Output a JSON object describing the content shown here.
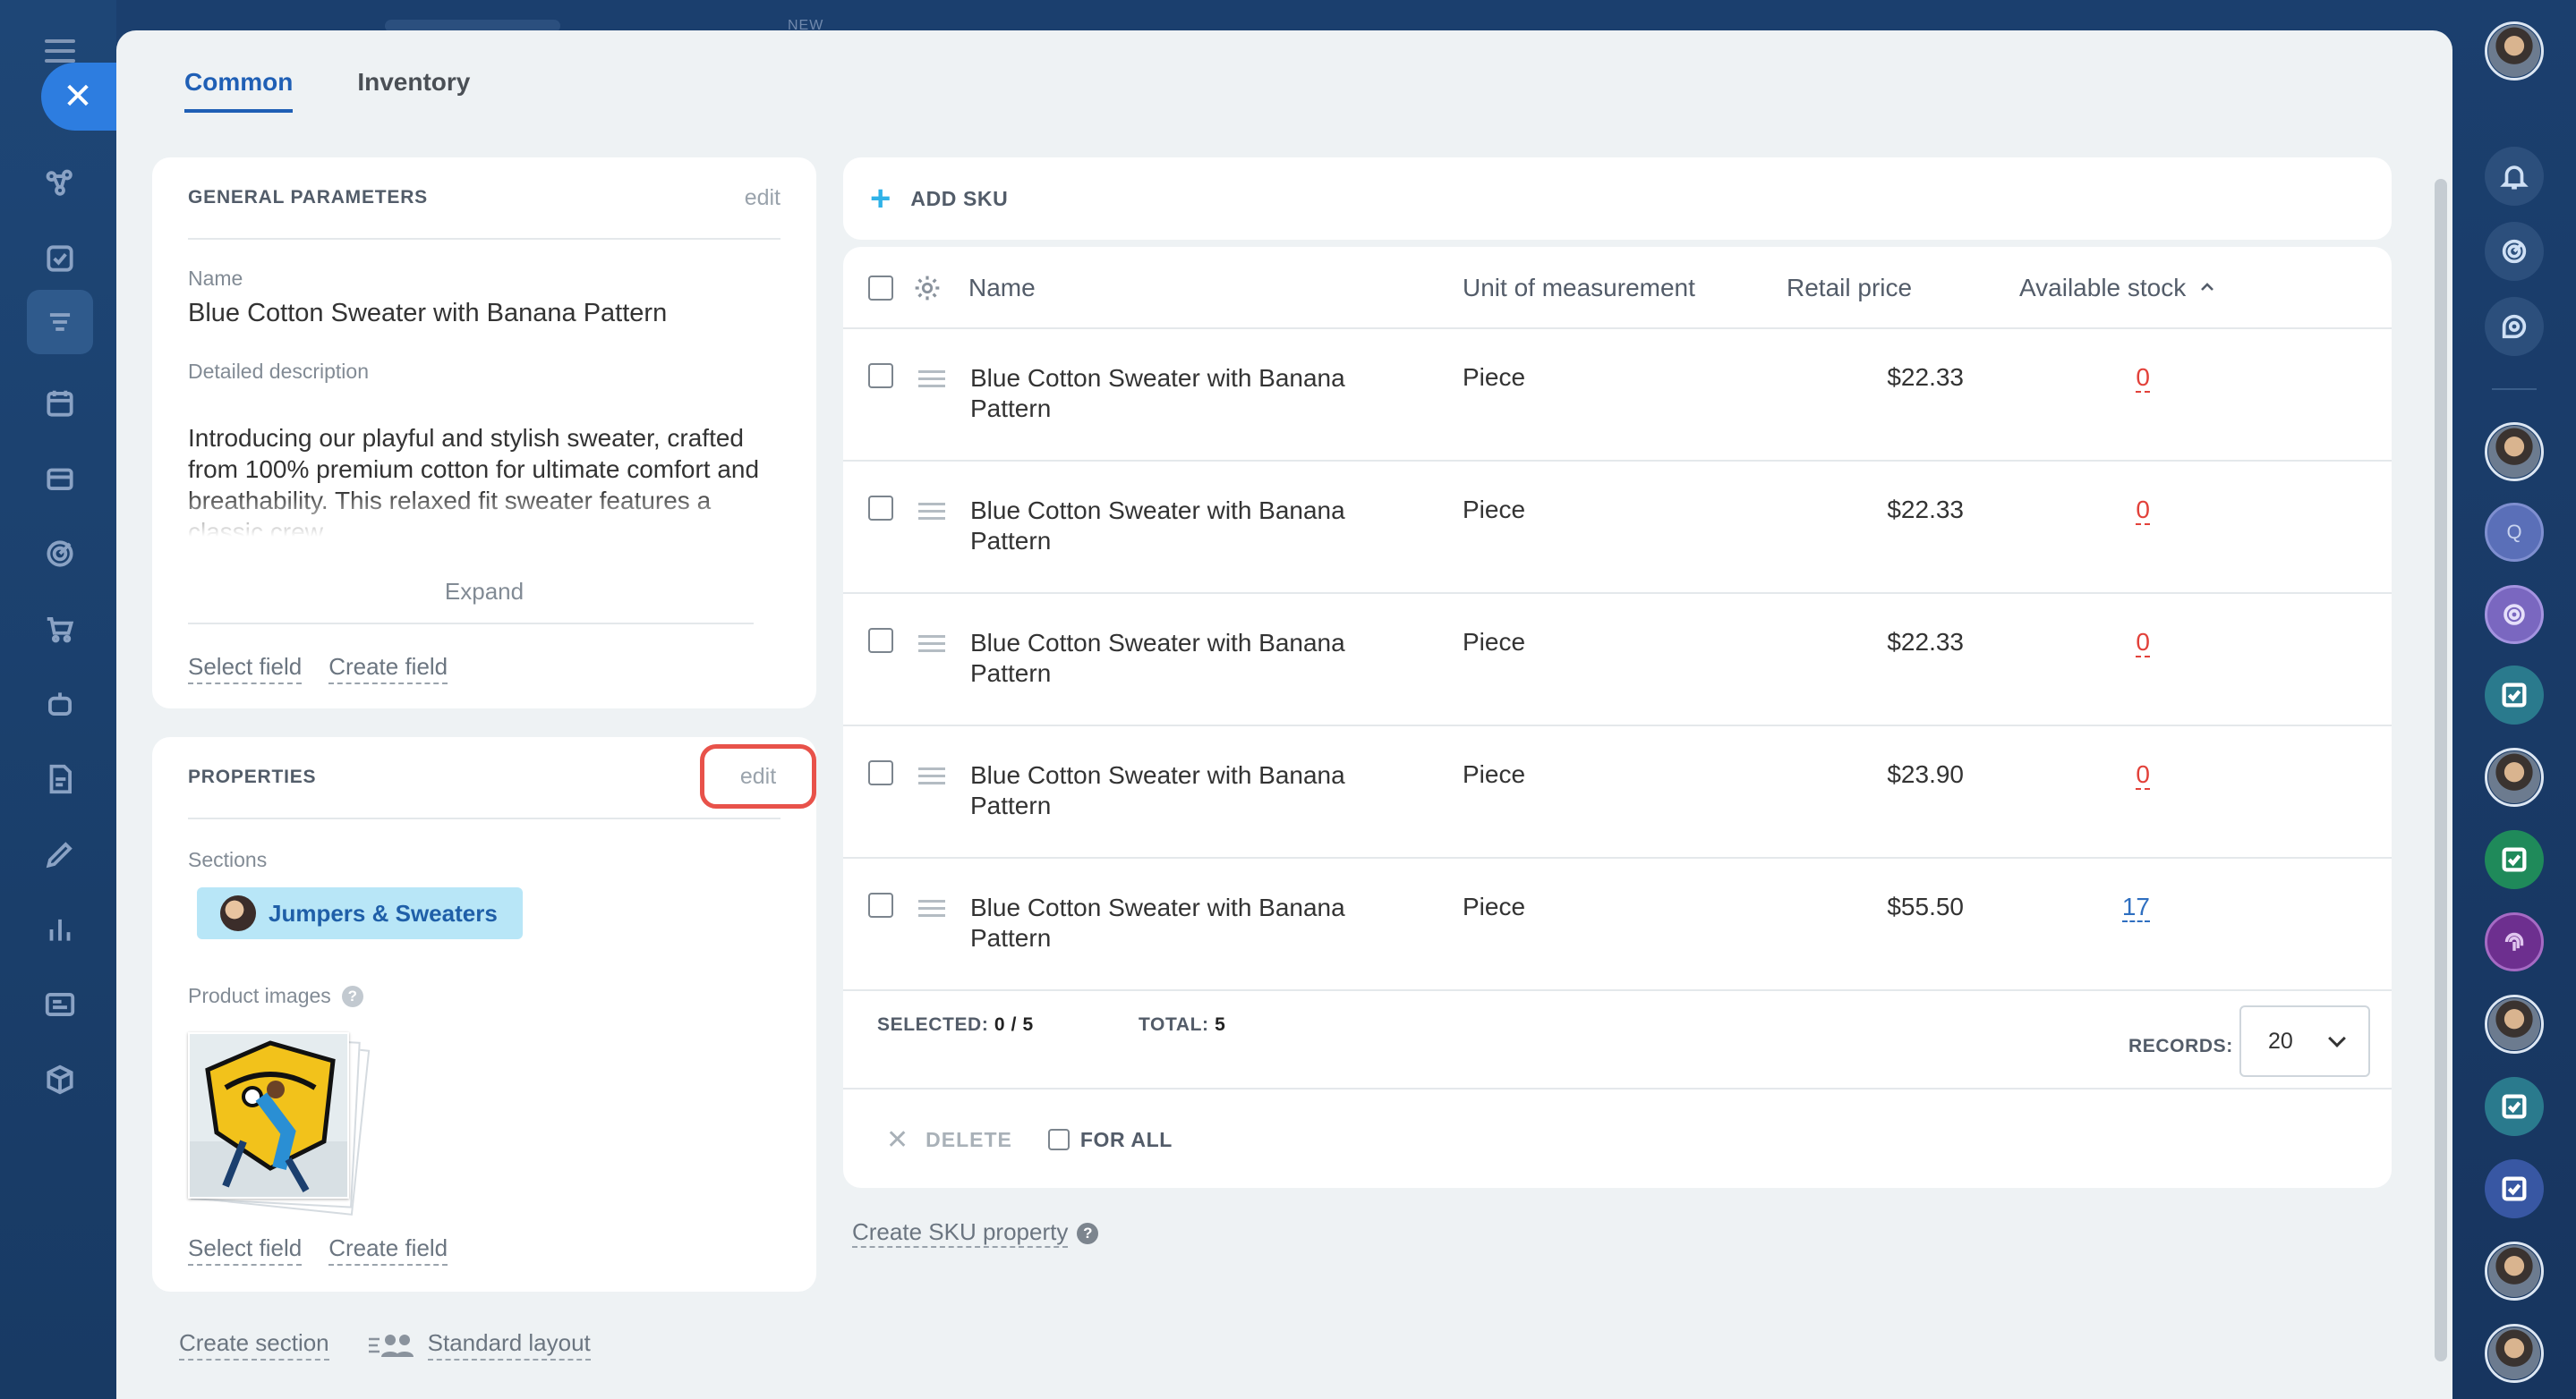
{
  "top": {
    "new_badge": "NEW"
  },
  "tabs": [
    {
      "label": "Common",
      "active": true
    },
    {
      "label": "Inventory",
      "active": false
    }
  ],
  "general": {
    "title": "GENERAL PARAMETERS",
    "edit": "edit",
    "name_label": "Name",
    "name_value": "Blue Cotton Sweater with Banana Pattern",
    "desc_label": "Detailed description",
    "desc_text": "Introducing our playful and stylish sweater, crafted from 100% premium cotton for ultimate comfort and breathability. This relaxed fit sweater features a classic crew",
    "expand": "Expand",
    "select_field": "Select field",
    "create_field": "Create field"
  },
  "properties": {
    "title": "PROPERTIES",
    "edit": "edit",
    "sections_label": "Sections",
    "section_chip": "Jumpers & Sweaters",
    "images_label": "Product images",
    "help": "?",
    "select_field": "Select field",
    "create_field": "Create field"
  },
  "bottom": {
    "create_section": "Create section",
    "standard_layout": "Standard layout"
  },
  "sku": {
    "add_label": "ADD SKU",
    "columns": {
      "name": "Name",
      "unit": "Unit of measurement",
      "price": "Retail price",
      "stock": "Available stock",
      "stock_sort": "asc"
    },
    "rows": [
      {
        "name": "Blue Cotton Sweater with Banana Pattern",
        "unit": "Piece",
        "price": "$22.33",
        "stock": "0"
      },
      {
        "name": "Blue Cotton Sweater with Banana Pattern",
        "unit": "Piece",
        "price": "$22.33",
        "stock": "0"
      },
      {
        "name": "Blue Cotton Sweater with Banana Pattern",
        "unit": "Piece",
        "price": "$22.33",
        "stock": "0"
      },
      {
        "name": "Blue Cotton Sweater with Banana Pattern",
        "unit": "Piece",
        "price": "$23.90",
        "stock": "0"
      },
      {
        "name": "Blue Cotton Sweater with Banana Pattern",
        "unit": "Piece",
        "price": "$55.50",
        "stock": "17"
      }
    ],
    "selected_label": "SELECTED:",
    "selected_value": "0 / 5",
    "total_label": "TOTAL:",
    "total_value": "5",
    "records_label": "RECORDS:",
    "records_value": "20",
    "delete_label": "DELETE",
    "for_all_label": "FOR ALL",
    "create_property": "Create SKU property",
    "help": "?"
  },
  "colors": {
    "accent": "#1f5fb5",
    "stock_zero": "#e2413a",
    "stock_positive": "#2f6fc0",
    "highlight": "#e8524a"
  },
  "right_bar": {
    "q_initial": "Q"
  }
}
